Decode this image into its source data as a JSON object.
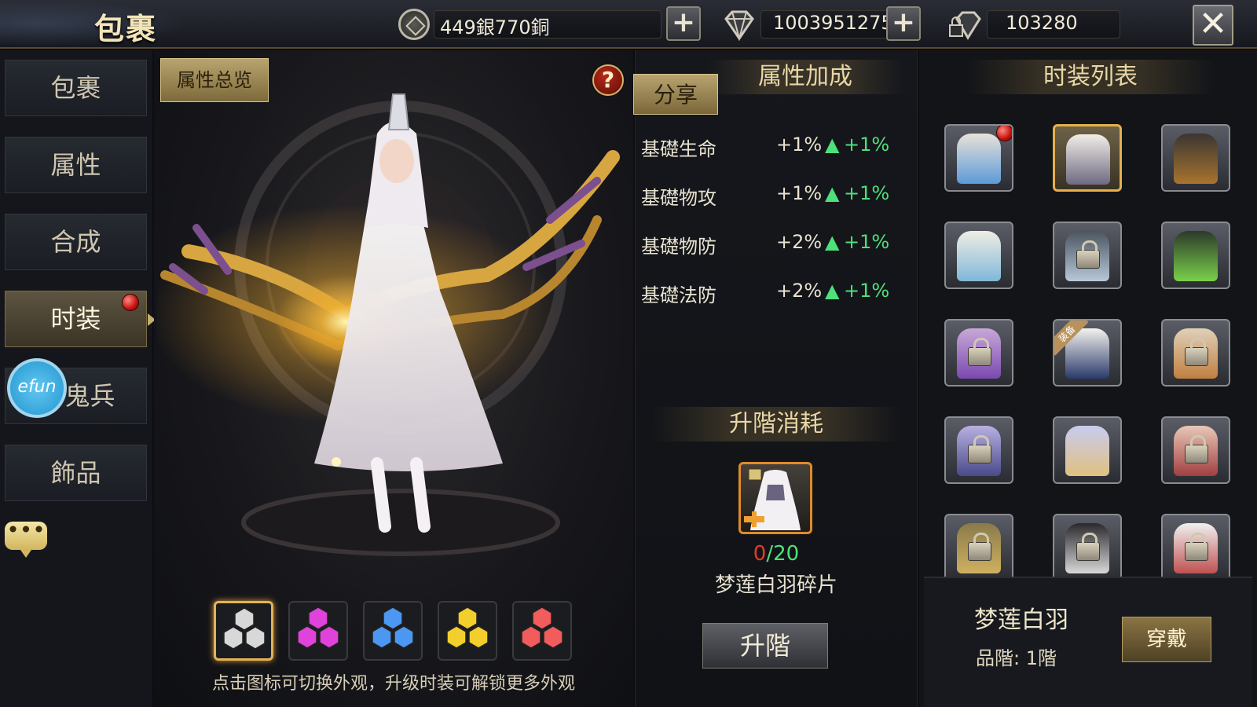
{
  "header": {
    "title": "包裹",
    "currency_text": "449銀770銅",
    "diamonds": "1003951275",
    "bound_diamonds": "103280",
    "icons": {
      "coin": "coin-icon",
      "diamond": "diamond-icon",
      "bound_diamond": "locked-diamond-icon",
      "close": "close-icon"
    }
  },
  "sidebar": {
    "items": [
      {
        "label": "包裹",
        "active": false
      },
      {
        "label": "属性",
        "active": false
      },
      {
        "label": "合成",
        "active": false
      },
      {
        "label": "时装",
        "active": true,
        "badge": true
      },
      {
        "label": "鬼兵",
        "active": false
      },
      {
        "label": "飾品",
        "active": false
      }
    ],
    "efun_label": "efun",
    "chat_label": "•••"
  },
  "character_panel": {
    "overview_tab": "属性总览",
    "help_label": "?",
    "color_options": [
      "#d8d8d8",
      "#e043dc",
      "#4b97f2",
      "#f2cf2c",
      "#f25c5c"
    ],
    "selected_color": 0,
    "hint": "点击图标可切换外观，升级时装可解锁更多外观"
  },
  "attributes": {
    "share_tab": "分享",
    "title": "属性加成",
    "rows": [
      {
        "name": "基礎生命",
        "value": "+1%",
        "bonus": "+1%"
      },
      {
        "name": "基礎物攻",
        "value": "+1%",
        "bonus": "+1%"
      },
      {
        "name": "基礎物防",
        "value": "+2%",
        "bonus": "+1%"
      },
      {
        "name": "基礎法防",
        "value": "+2%",
        "bonus": "+1%"
      }
    ],
    "cost_title": "升階消耗",
    "fragment_have": "0",
    "fragment_need": "/20",
    "fragment_name": "梦莲白羽碎片",
    "upgrade_label": "升階"
  },
  "costume_list": {
    "title": "时装列表",
    "items": [
      {
        "locked": false,
        "selected": false,
        "badge": true,
        "equipped": false,
        "art": "#e8e2d8",
        "accent": "#5c9ad8"
      },
      {
        "locked": false,
        "selected": true,
        "badge": false,
        "equipped": false,
        "art": "#f1eee8",
        "accent": "#6f6a82"
      },
      {
        "locked": false,
        "selected": false,
        "badge": false,
        "equipped": false,
        "art": "#3a3632",
        "accent": "#a8742e"
      },
      {
        "locked": false,
        "selected": false,
        "badge": false,
        "equipped": false,
        "art": "#f0ede4",
        "accent": "#7fb8d8"
      },
      {
        "locked": true,
        "selected": false,
        "badge": false,
        "equipped": false,
        "art": "#4a5560",
        "accent": "#b8c8d8"
      },
      {
        "locked": false,
        "selected": false,
        "badge": false,
        "equipped": false,
        "art": "#2c3a2a",
        "accent": "#7ad04a"
      },
      {
        "locked": true,
        "selected": false,
        "badge": false,
        "equipped": false,
        "art": "#c8a8d8",
        "accent": "#7a4ab0"
      },
      {
        "locked": false,
        "selected": false,
        "badge": false,
        "equipped": true,
        "equipped_label": "装备",
        "art": "#f4f2ee",
        "accent": "#2a3a6a"
      },
      {
        "locked": true,
        "selected": false,
        "badge": false,
        "equipped": false,
        "art": "#e0d0b8",
        "accent": "#c08040"
      },
      {
        "locked": true,
        "selected": false,
        "badge": false,
        "equipped": false,
        "art": "#b8b0e0",
        "accent": "#4a4a8a"
      },
      {
        "locked": false,
        "selected": false,
        "badge": false,
        "equipped": false,
        "art": "#c8ccf0",
        "accent": "#e0c080"
      },
      {
        "locked": true,
        "selected": false,
        "badge": false,
        "equipped": false,
        "art": "#e8c8b8",
        "accent": "#a04040"
      },
      {
        "locked": true,
        "selected": false,
        "badge": false,
        "equipped": false,
        "art": "#8a7a4a",
        "accent": "#d0b060"
      },
      {
        "locked": true,
        "selected": false,
        "badge": false,
        "equipped": false,
        "art": "#2a2a2e",
        "accent": "#d8d8d8"
      },
      {
        "locked": true,
        "selected": false,
        "badge": false,
        "equipped": false,
        "art": "#f0f0f0",
        "accent": "#c05050"
      }
    ],
    "selected_name": "梦莲白羽",
    "grade_label": "品階: 1階",
    "wear_label": "穿戴"
  }
}
